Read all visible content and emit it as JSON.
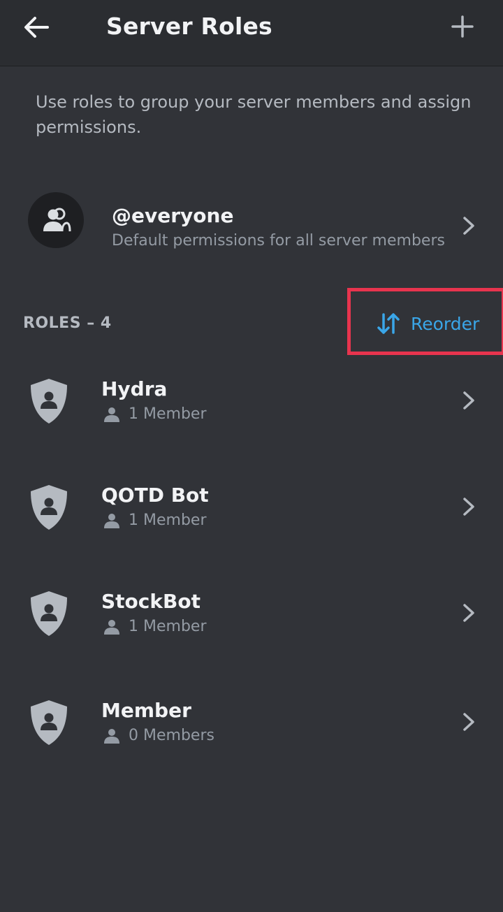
{
  "header": {
    "title": "Server Roles",
    "back_icon": "arrow-left-icon",
    "add_icon": "plus-icon"
  },
  "intro": "Use roles to group your server members and assign permissions.",
  "everyone": {
    "name": "@everyone",
    "description": "Default permissions for all server members",
    "icon": "people-icon"
  },
  "roles_section": {
    "heading": "ROLES – 4",
    "reorder_label": "Reorder",
    "reorder_icon": "up-down-arrows-icon"
  },
  "roles": [
    {
      "name": "Hydra",
      "members": "1 Member"
    },
    {
      "name": "QOTD Bot",
      "members": "1 Member"
    },
    {
      "name": "StockBot",
      "members": "1 Member"
    },
    {
      "name": "Member",
      "members": "0 Members"
    }
  ],
  "colors": {
    "background": "#313338",
    "topbar": "#2b2d31",
    "accent": "#3aa6e8",
    "highlight": "#e8344e",
    "shield": "#b5bac1"
  }
}
